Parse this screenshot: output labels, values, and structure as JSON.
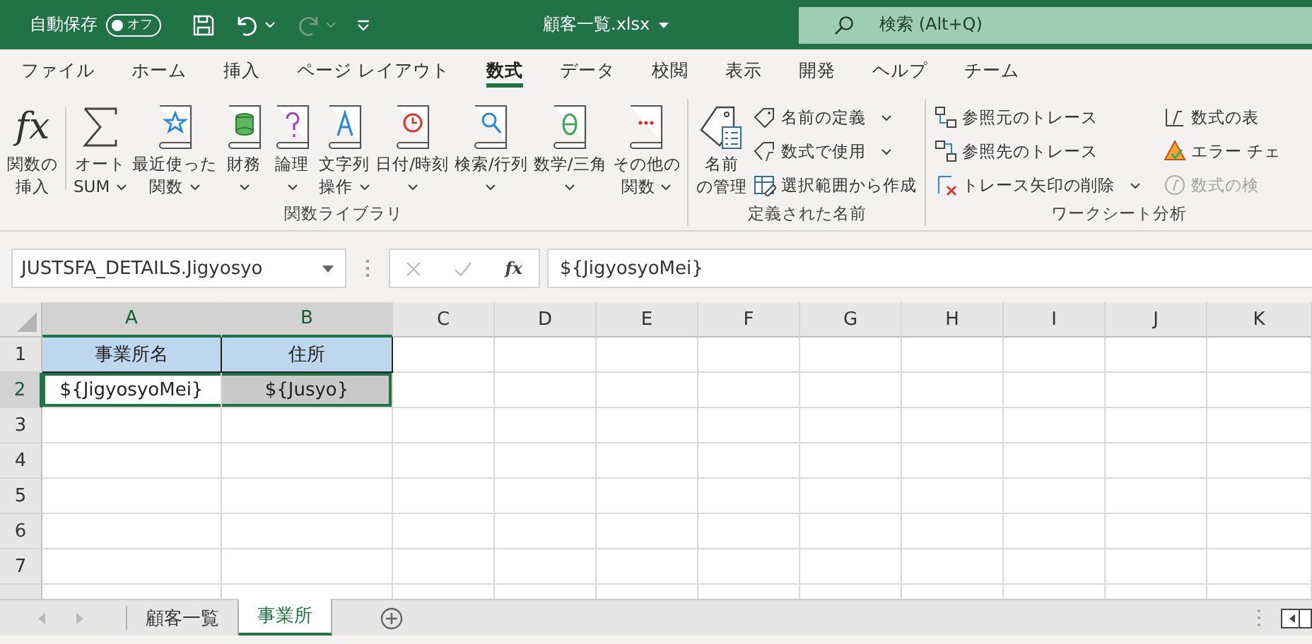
{
  "title_bar": {
    "autosave_label": "自動保存",
    "autosave_toggle": {
      "label": "オフ",
      "on": false
    },
    "quick_access": [
      {
        "kind": "save",
        "disabled": false
      },
      {
        "kind": "undo",
        "disabled": false
      },
      {
        "kind": "redo",
        "disabled": true
      },
      {
        "kind": "customize",
        "disabled": false
      }
    ],
    "filename": "顧客一覧.xlsx",
    "search": {
      "placeholder": "検索 (Alt+Q)"
    }
  },
  "menu_tabs": [
    {
      "label": "ファイル",
      "selected": false
    },
    {
      "label": "ホーム",
      "selected": false
    },
    {
      "label": "挿入",
      "selected": false
    },
    {
      "label": "ページ レイアウト",
      "selected": false
    },
    {
      "label": "数式",
      "selected": true
    },
    {
      "label": "データ",
      "selected": false
    },
    {
      "label": "校閲",
      "selected": false
    },
    {
      "label": "表示",
      "selected": false
    },
    {
      "label": "開発",
      "selected": false
    },
    {
      "label": "ヘルプ",
      "selected": false
    },
    {
      "label": "チーム",
      "selected": false
    }
  ],
  "ribbon": {
    "groups": [
      {
        "label": "関数ライブラリ",
        "items": [
          {
            "kind": "large",
            "glyph": "fx",
            "label_lines": [
              "関数の",
              "挿入"
            ],
            "dropdown": false
          },
          {
            "kind": "large",
            "label_lines": [
              "オート",
              "SUM"
            ],
            "dropdown": true
          },
          {
            "kind": "large",
            "label_lines": [
              "最近使った",
              "関数"
            ],
            "dropdown": true
          },
          {
            "kind": "large",
            "label_lines": [
              "財務"
            ],
            "dropdown": true
          },
          {
            "kind": "large",
            "label_lines": [
              "論理"
            ],
            "dropdown": true
          },
          {
            "kind": "large",
            "label_lines": [
              "文字列",
              "操作"
            ],
            "dropdown": true
          },
          {
            "kind": "large",
            "label_lines": [
              "日付/時刻"
            ],
            "dropdown": true
          },
          {
            "kind": "large",
            "label_lines": [
              "検索/行列"
            ],
            "dropdown": true
          },
          {
            "kind": "large",
            "label_lines": [
              "数学/三角"
            ],
            "dropdown": true
          },
          {
            "kind": "large",
            "label_lines": [
              "その他の",
              "関数"
            ],
            "dropdown": true
          }
        ]
      },
      {
        "label": "定義された名前",
        "items": [
          {
            "kind": "large",
            "label_lines": [
              "名前",
              "の管理"
            ],
            "dropdown": false
          },
          {
            "kind": "small",
            "label": "名前の定義",
            "dropdown": true,
            "disabled": false
          },
          {
            "kind": "small",
            "label": "数式で使用",
            "dropdown": true,
            "disabled": false
          },
          {
            "kind": "small",
            "label": "選択範囲から作成",
            "dropdown": false,
            "disabled": false
          }
        ]
      },
      {
        "label": "ワークシート分析",
        "items": [
          {
            "kind": "small",
            "label": "参照元のトレース",
            "dropdown": false,
            "disabled": false
          },
          {
            "kind": "small",
            "label": "参照先のトレース",
            "dropdown": false,
            "disabled": false
          },
          {
            "kind": "small",
            "label": "トレース矢印の削除",
            "dropdown": true,
            "disabled": false
          },
          {
            "kind": "small",
            "label": "数式の表",
            "dropdown": false,
            "disabled": false
          },
          {
            "kind": "small",
            "label": "エラー チェ",
            "dropdown": false,
            "disabled": false
          },
          {
            "kind": "small",
            "label": "数式の検",
            "dropdown": false,
            "disabled": true
          }
        ]
      }
    ]
  },
  "formula_bar": {
    "name_box": "JUSTSFA_DETAILS.Jigyosyo",
    "insert_function_glyph": "fx",
    "formula": "${JigyosyoMei}"
  },
  "sheet": {
    "columns": [
      {
        "label": "A",
        "selected": true
      },
      {
        "label": "B",
        "selected": true
      },
      {
        "label": "C",
        "selected": false
      },
      {
        "label": "D",
        "selected": false
      },
      {
        "label": "E",
        "selected": false
      },
      {
        "label": "F",
        "selected": false
      },
      {
        "label": "G",
        "selected": false
      },
      {
        "label": "H",
        "selected": false
      },
      {
        "label": "I",
        "selected": false
      },
      {
        "label": "J",
        "selected": false
      },
      {
        "label": "K",
        "selected": false
      }
    ],
    "rows": [
      {
        "label": "1",
        "selected": false,
        "cells": [
          {
            "text": "事業所名",
            "kind": "header",
            "selected": false
          },
          {
            "text": "住所",
            "kind": "header",
            "selected": false
          }
        ]
      },
      {
        "label": "2",
        "selected": true,
        "cells": [
          {
            "text": "${JigyosyoMei}",
            "kind": "plain",
            "selected": true
          },
          {
            "text": "${Jusyo}",
            "kind": "shaded",
            "selected": true
          }
        ]
      },
      {
        "label": "3",
        "selected": false
      },
      {
        "label": "4",
        "selected": false
      },
      {
        "label": "5",
        "selected": false
      },
      {
        "label": "6",
        "selected": false
      },
      {
        "label": "7",
        "selected": false
      }
    ]
  },
  "sheet_tabs": [
    {
      "label": "顧客一覧",
      "selected": false
    },
    {
      "label": "事業所",
      "selected": true
    }
  ]
}
